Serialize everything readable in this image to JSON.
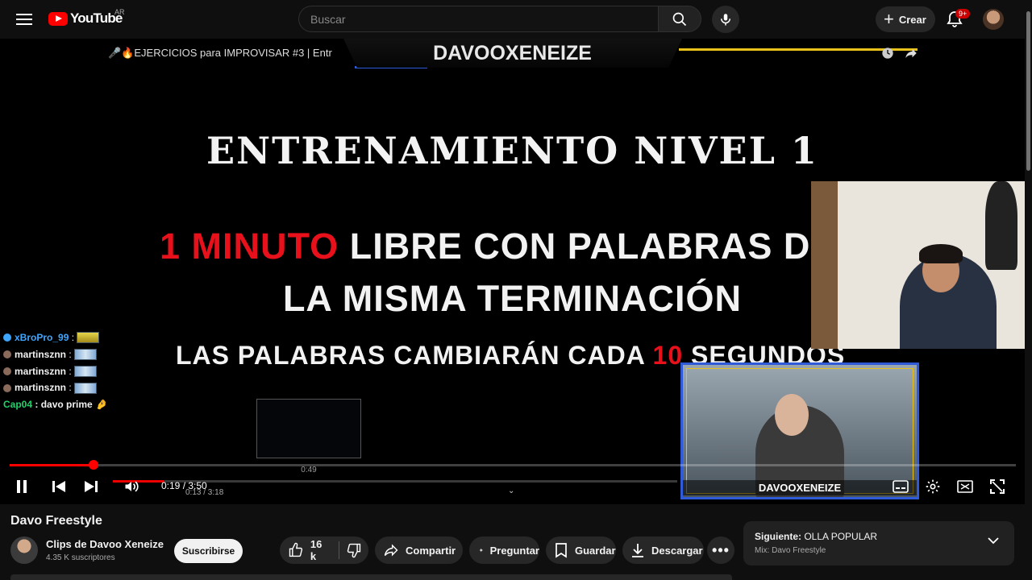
{
  "header": {
    "logo_text": "YouTube",
    "region": "AR",
    "search_placeholder": "Buscar",
    "create_label": "Crear",
    "notif_badge": "9+"
  },
  "player": {
    "nested_title": "🎤🔥EJERCICIOS para IMPROVISAR #3 | Entr",
    "banner_text": "DAVOOXENEIZE",
    "slide": {
      "title": "ENTRENAMIENTO NIVEL 1",
      "line1_red": "1 MINUTO",
      "line1_rest": " LIBRE CON PALABRAS DE",
      "line2": "LA MISMA TERMINACIÓN",
      "line3_pre": "LAS PALABRAS CAMBIARÁN CADA ",
      "line3_red": "10",
      "line3_post": " SEGUNDOS"
    },
    "chat": [
      {
        "name": "xBroPro_99",
        "color": "#3ea6ff",
        "text": ":"
      },
      {
        "name": "martinsznn",
        "color": "#f1f1f1",
        "text": ":"
      },
      {
        "name": "martinsznn",
        "color": "#f1f1f1",
        "text": ":"
      },
      {
        "name": "martinsznn",
        "color": "#f1f1f1",
        "text": ":"
      },
      {
        "name": "Cap04",
        "color": "#1fd36a",
        "text": ": davo prime"
      }
    ],
    "preview_time": "0:49",
    "time_current": "0:19",
    "time_total": "3:50",
    "time_display": "0:19 / 3:50",
    "nested_time_display": "0:13 / 3:18",
    "progress_fraction": 0.083,
    "webcam_label": "DAVOOXENEIZE"
  },
  "video": {
    "title": "Davo Freestyle",
    "channel_name": "Clips de Davoo Xeneize",
    "subscribers": "4.35 K suscriptores",
    "subscribe_label": "Suscribirse",
    "likes": "16 k",
    "share_label": "Compartir",
    "ask_label": "Preguntar",
    "save_label": "Guardar",
    "download_label": "Descargar"
  },
  "next": {
    "prefix": "Siguiente: ",
    "title": "OLLA POPULAR",
    "mix": "Mix: Davo Freestyle"
  },
  "colors": {
    "accent": "#ff0000",
    "brand": "#ff0000"
  }
}
